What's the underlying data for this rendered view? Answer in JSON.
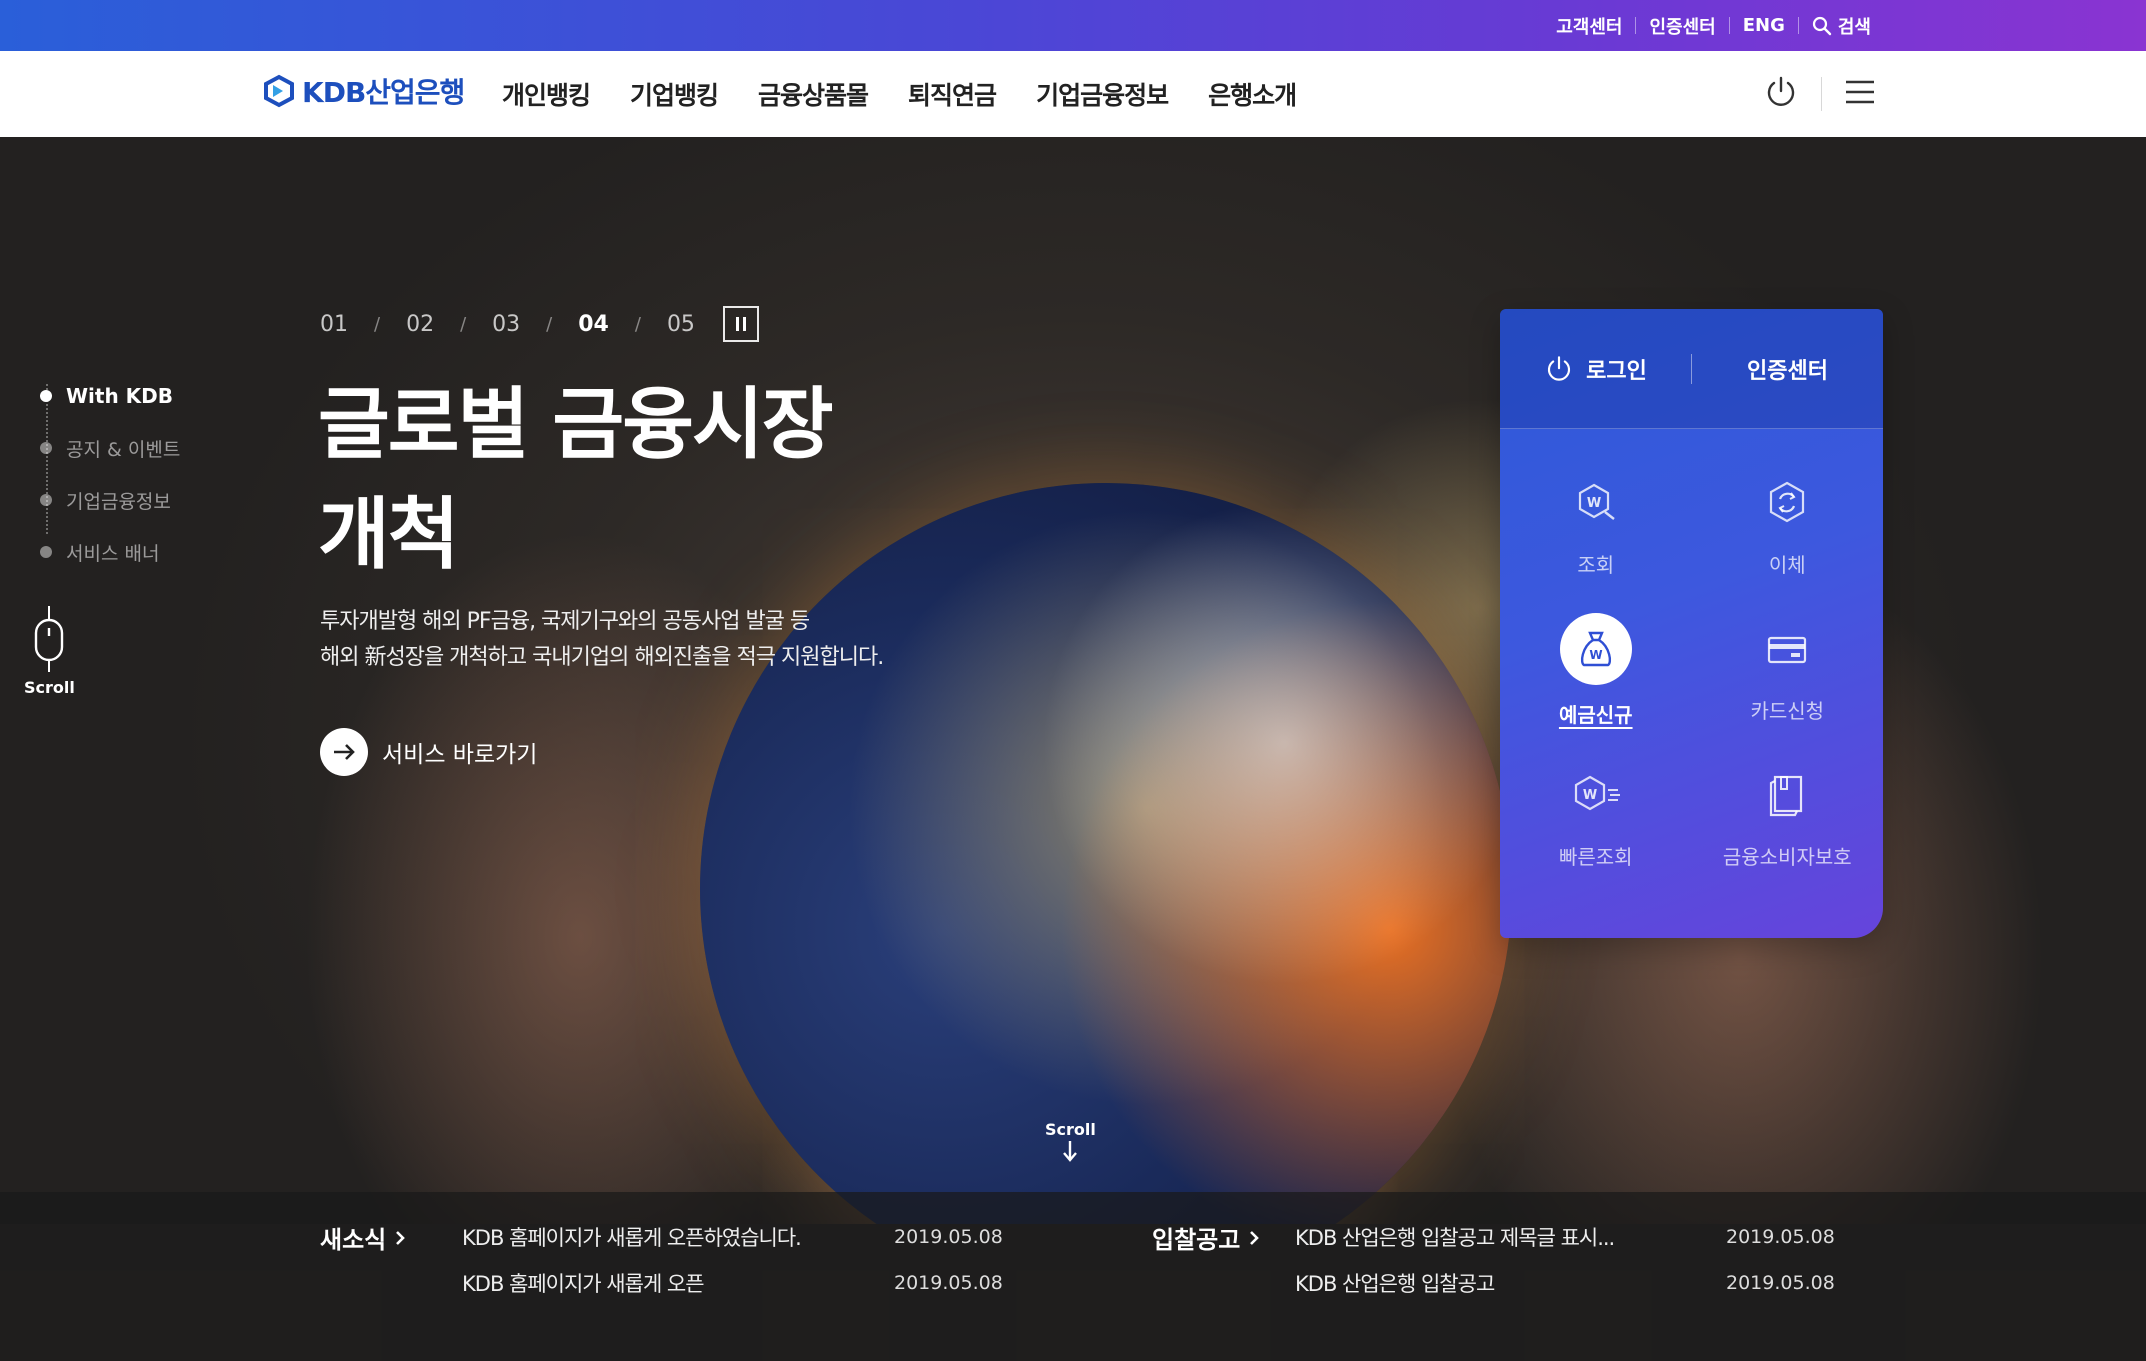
{
  "topbar": {
    "links": [
      "고객센터",
      "인증센터",
      "ENG"
    ],
    "search_label": "검색"
  },
  "header": {
    "logo_text": "KDB산업은행",
    "menu": [
      "개인뱅킹",
      "기업뱅킹",
      "금융상품몰",
      "퇴직연금",
      "기업금융정보",
      "은행소개"
    ]
  },
  "sidenav": {
    "items": [
      "With KDB",
      "공지 & 이벤트",
      "기업금융정보",
      "서비스 배너"
    ],
    "active_index": 0,
    "scroll_label": "Scroll"
  },
  "slider": {
    "pages": [
      "01",
      "02",
      "03",
      "04",
      "05"
    ],
    "active_index": 3,
    "separator": "/"
  },
  "hero": {
    "headline_line1": "글로벌 금융시장",
    "headline_line2": "개척",
    "desc_line1": "투자개발형 해외 PF금융, 국제기구와의 공동사업 발굴 등",
    "desc_line2": "해외 新성장을 개척하고 국내기업의 해외진출을 적극 지원합니다.",
    "cta_label": "서비스 바로가기",
    "scroll_label": "Scroll"
  },
  "quick_panel": {
    "login_label": "로그인",
    "cert_label": "인증센터",
    "items": [
      {
        "label": "조회",
        "icon": "won-search-icon"
      },
      {
        "label": "이체",
        "icon": "transfer-icon"
      },
      {
        "label": "예금신규",
        "icon": "money-bag-icon"
      },
      {
        "label": "카드신청",
        "icon": "card-icon"
      },
      {
        "label": "빠른조회",
        "icon": "quick-search-icon"
      },
      {
        "label": "금융소비자보호",
        "icon": "book-icon"
      }
    ],
    "active_index": 2
  },
  "news": {
    "left": {
      "title": "새소식",
      "rows": [
        {
          "text": "KDB 홈페이지가 새롭게 오픈하였습니다.",
          "date": "2019.05.08"
        },
        {
          "text": "KDB 홈페이지가 새롭게 오픈",
          "date": "2019.05.08"
        }
      ]
    },
    "right": {
      "title": "입찰공고",
      "rows": [
        {
          "text": "KDB 산업은행 입찰공고 제목글 표시...",
          "date": "2019.05.08"
        },
        {
          "text": "KDB 산업은행 입찰공고",
          "date": "2019.05.08"
        }
      ]
    }
  },
  "colors": {
    "brand_blue": "#1d4fbd",
    "topbar_start": "#2a5fd9",
    "topbar_end": "#8a34d2"
  }
}
